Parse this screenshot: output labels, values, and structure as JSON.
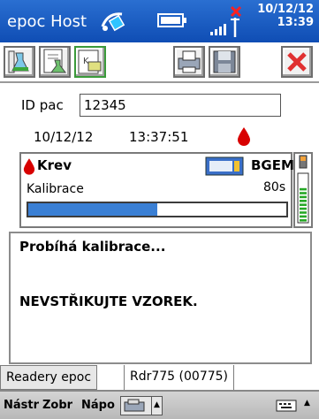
{
  "title_bar": {
    "app_title": "epoc Host",
    "date": "10/12/12",
    "time": "13:39",
    "icons": [
      "sync-icon",
      "battery-icon",
      "signal-no-connection-icon"
    ]
  },
  "toolbar": {
    "buttons": [
      "test-new-icon",
      "test-list-icon",
      "reader-config-icon",
      "print-icon",
      "save-icon",
      "close-icon"
    ]
  },
  "patient": {
    "id_label": "ID pac",
    "id_value": "12345",
    "date": "10/12/12",
    "time": "13:37:51"
  },
  "status": {
    "sample_type": "Krev",
    "card_type": "BGEM",
    "phase_label": "Kalibrace",
    "remaining": "80s",
    "progress_fraction": 0.5
  },
  "battery": {
    "level_fraction": 0.78
  },
  "message": {
    "line1": "Probíhá kalibrace...",
    "line2": "NEVSTŘIKUJTE VZOREK."
  },
  "tabs": [
    {
      "label": "Readery epoc",
      "active": false
    },
    {
      "label": "Rdr775 (00775)",
      "active": true
    }
  ],
  "menu": {
    "items": [
      "Nástr",
      "Zobr",
      "Nápo"
    ]
  },
  "colors": {
    "title_bar": "#1a5cc8",
    "progress_fill": "#3a7fd4",
    "blood_red": "#d80000",
    "close_red": "#e03030",
    "battery_green": "#27a827"
  }
}
